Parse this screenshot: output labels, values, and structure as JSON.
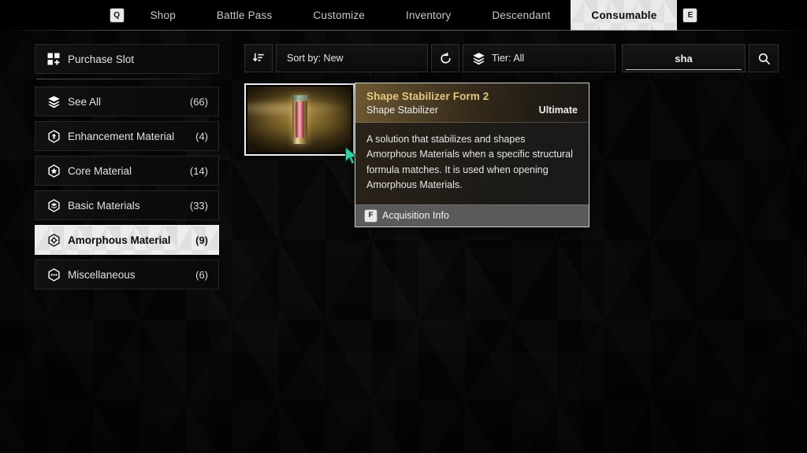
{
  "topnav": {
    "left_key": "Q",
    "right_key": "E",
    "items": [
      {
        "label": "Shop",
        "active": false
      },
      {
        "label": "Battle Pass",
        "active": false
      },
      {
        "label": "Customize",
        "active": false
      },
      {
        "label": "Inventory",
        "active": false
      },
      {
        "label": "Descendant",
        "active": false
      },
      {
        "label": "Consumable",
        "active": true
      }
    ]
  },
  "sidebar": {
    "purchase_slot": {
      "label": "Purchase Slot",
      "icon": "grid-plus-icon"
    },
    "items": [
      {
        "label": "See All",
        "count": "(66)",
        "icon": "layers-icon",
        "selected": false
      },
      {
        "label": "Enhancement Material",
        "count": "(4)",
        "icon": "hex-arrow-up-icon",
        "selected": false
      },
      {
        "label": "Core Material",
        "count": "(14)",
        "icon": "hex-star-icon",
        "selected": false
      },
      {
        "label": "Basic Materials",
        "count": "(33)",
        "icon": "hex-layers-icon",
        "selected": false
      },
      {
        "label": "Amorphous Material",
        "count": "(9)",
        "icon": "hex-crosshair-icon",
        "selected": true
      },
      {
        "label": "Miscellaneous",
        "count": "(6)",
        "icon": "hex-ellipsis-icon",
        "selected": false
      }
    ]
  },
  "toolbar": {
    "sort_icon": "sort-descending-icon",
    "sort_label": "Sort by: New",
    "reset_icon": "refresh-icon",
    "tier_icon": "layers-icon",
    "tier_label": "Tier: All",
    "search_value": "sha",
    "search_placeholder": "Search",
    "search_icon": "search-icon"
  },
  "grid": {
    "items": [
      {
        "name": "Shape Stabilizer Form 2",
        "icon": "vial-item-icon",
        "selected": true
      }
    ]
  },
  "tooltip": {
    "title": "Shape Stabilizer Form 2",
    "subtitle": "Shape Stabilizer",
    "rarity": "Ultimate",
    "description": "A solution that stabilizes and shapes Amorphous Materials when a specific structural formula matches. It is used when opening Amorphous Materials.",
    "footer_key": "F",
    "footer_label": "Acquisition Info"
  },
  "colors": {
    "accent_gold": "#e4c87f",
    "selection_light": "#ededed",
    "cursor_teal": "#2fd2a4",
    "tooltip_border": "#cfcfcf"
  }
}
